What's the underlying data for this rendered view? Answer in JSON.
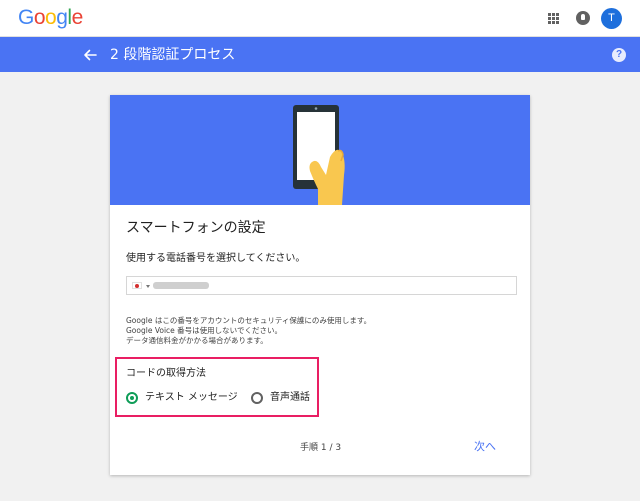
{
  "header": {
    "logo_letters": [
      {
        "char": "G",
        "color": "#4285f4"
      },
      {
        "char": "o",
        "color": "#ea4335"
      },
      {
        "char": "o",
        "color": "#fbbc05"
      },
      {
        "char": "g",
        "color": "#4285f4"
      },
      {
        "char": "l",
        "color": "#34a853"
      },
      {
        "char": "e",
        "color": "#ea4335"
      }
    ],
    "apps_icon": "apps-grid-icon",
    "notifications_icon": "notifications-icon",
    "avatar_initial": "T"
  },
  "titlebar": {
    "back_icon": "arrow-back-icon",
    "title": "2 段階認証プロセス",
    "help_symbol": "?",
    "background": "#4a73f3"
  },
  "card": {
    "hero_image": "smartphone-in-hand-illustration",
    "title": "スマートフォンの設定",
    "subtitle": "使用する電話番号を選択してください。",
    "phone_input": {
      "country_flag": "japan-flag-icon",
      "value_obscured": true
    },
    "info_lines": [
      "Google はこの番号をアカウントのセキュリティ保護にのみ使用します。",
      "Google Voice 番号は使用しないでください。",
      "データ通信料金がかかる場合があります。"
    ],
    "method": {
      "label": "コードの取得方法",
      "options": [
        {
          "label": "テキスト メッセージ",
          "selected": true
        },
        {
          "label": "音声通話",
          "selected": false
        }
      ]
    },
    "step": "手順 1 / 3",
    "next_label": "次へ"
  },
  "colors": {
    "accent_blue": "#4a73f3",
    "radio_selected": "#0f9d58",
    "highlight_border": "#e91e63"
  }
}
